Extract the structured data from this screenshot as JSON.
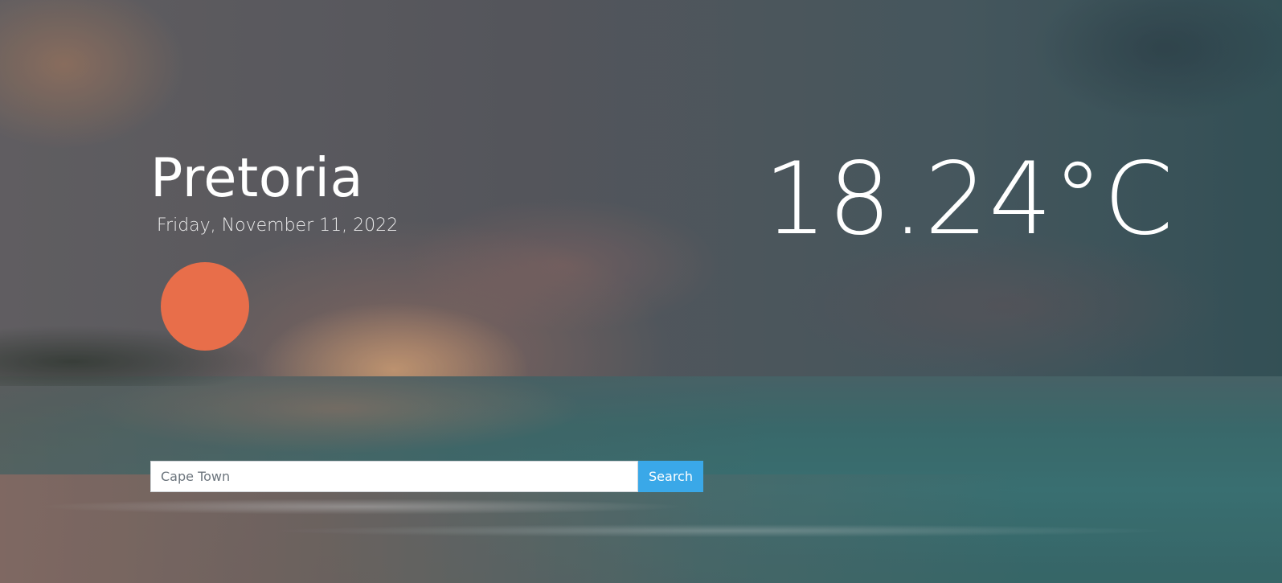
{
  "weather": {
    "city": "Pretoria",
    "date": "Friday, November 11, 2022",
    "temperature": "18.24°C",
    "icon": "sun-icon",
    "icon_color": "#e86e4a"
  },
  "search": {
    "placeholder": "Cape Town",
    "button_label": "Search",
    "button_color": "#3aa8e8"
  }
}
